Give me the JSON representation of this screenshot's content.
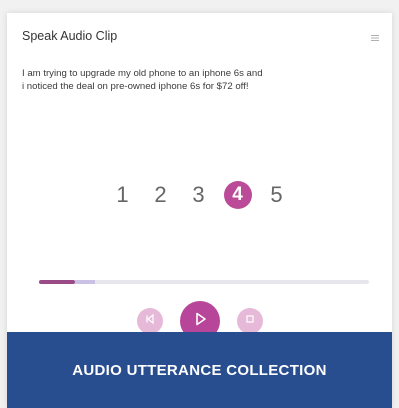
{
  "card": {
    "title": "Speak Audio Clip",
    "menu_icon": "hamburger-menu-icon",
    "prompt": "I am trying to upgrade my old phone to an iphone 6s and\ni noticed the deal on pre-owned iphone 6s for $72 off!"
  },
  "rating": {
    "options": [
      "1",
      "2",
      "3",
      "4",
      "5"
    ],
    "selected": "4"
  },
  "playback": {
    "progress_fraction": 0.11,
    "buffered_fraction": 0.17,
    "prev_icon": "skip-back-icon",
    "play_icon": "play-icon",
    "next_icon": "stop-icon"
  },
  "banner": {
    "label": "AUDIO UTTERANCE COLLECTION"
  },
  "colors": {
    "accent": "#b7459a",
    "accent_light": "#e7b9d8",
    "banner": "#294e8f"
  }
}
